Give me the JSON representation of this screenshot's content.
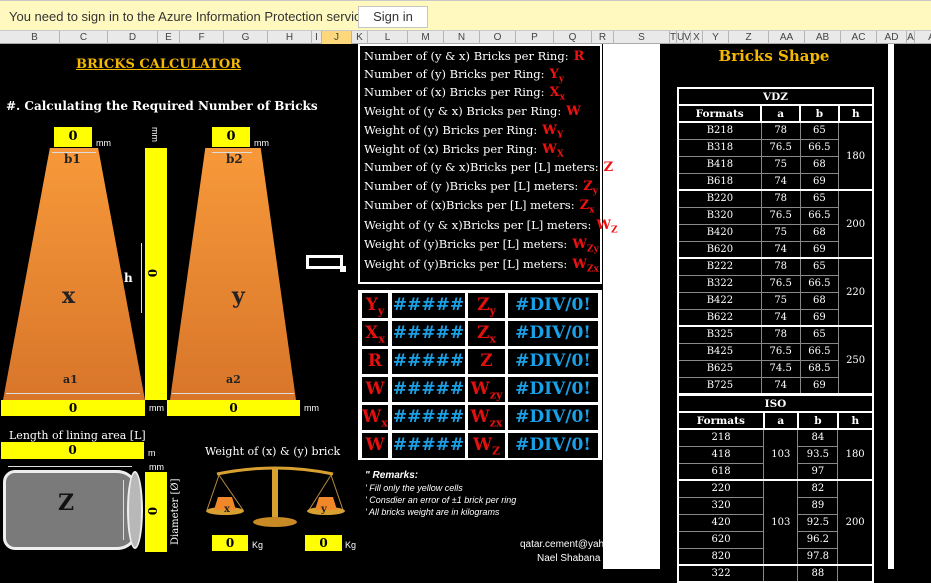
{
  "infobar": {
    "message": "You need to sign in to the Azure Information Protection service",
    "signin_label": "Sign in"
  },
  "columns": [
    "B",
    "C",
    "D",
    "E",
    "F",
    "G",
    "H",
    "I",
    "J",
    "K",
    "L",
    "M",
    "N",
    "O",
    "P",
    "Q",
    "R",
    "S",
    "T",
    "U",
    "V",
    "X",
    "Y",
    "Z",
    "AA",
    "AB",
    "AC",
    "AD",
    "A",
    "AF"
  ],
  "selected_column": "J",
  "calculator": {
    "title": "BRICKS CALCULATOR",
    "section_heading": "#. Calculating the Required Number of Bricks",
    "b1": {
      "label": "b1",
      "value": "0",
      "unit": "mm"
    },
    "b2": {
      "label": "b2",
      "value": "0",
      "unit": "mm"
    },
    "h": {
      "label": "h",
      "value": "0",
      "unit_top": "mm",
      "unit_bottom": "mm"
    },
    "a1": {
      "label": "a1",
      "value": "0",
      "unit": "mm"
    },
    "a2": {
      "label": "a2",
      "value": "0",
      "unit": "mm"
    },
    "brick_x_label": "x",
    "brick_y_label": "y",
    "length": {
      "label": "Length of lining area [L]",
      "value": "0",
      "unit": "m"
    },
    "cylinder_label": "Z",
    "diameter": {
      "label": "Diameter [Ø]",
      "value": "0",
      "unit": "mm"
    },
    "weight": {
      "label": "Weight of (x) & (y) brick",
      "x": {
        "pan_label": "x",
        "value": "0",
        "unit": "Kg"
      },
      "y": {
        "pan_label": "y",
        "value": "0",
        "unit": "Kg"
      }
    }
  },
  "definitions": [
    {
      "text": "Number of (y & x) Bricks per Ring:",
      "symbol": "R",
      "sub": ""
    },
    {
      "text": "Number of (y) Bricks per Ring:",
      "symbol": "Y",
      "sub": "y"
    },
    {
      "text": "Number of (x) Bricks per Ring:",
      "symbol": "X",
      "sub": "x"
    },
    {
      "text": "Weight of (y & x) Bricks per Ring:",
      "symbol": "W",
      "sub": ""
    },
    {
      "text": "Weight of (y) Bricks per Ring:",
      "symbol": "W",
      "sub": "Y"
    },
    {
      "text": "Weight of (x) Bricks per Ring:",
      "symbol": "W",
      "sub": "X"
    },
    {
      "text": "Number of (y & x)Bricks per [L] meters:",
      "symbol": "Z",
      "sub": ""
    },
    {
      "text": "Number of (y )Bricks per [L] meters:",
      "symbol": "Z",
      "sub": "y"
    },
    {
      "text": "Number of (x)Bricks per [L] meters:",
      "symbol": "Z",
      "sub": "x"
    },
    {
      "text": "Weight of (y & x)Bricks per  [L] meters:",
      "symbol": "W",
      "sub": "Z"
    },
    {
      "text": "Weight of (y)Bricks per [L] meters:",
      "symbol": "W",
      "sub": "Zy"
    },
    {
      "text": "Weight of (y)Bricks per [L] meters:",
      "symbol": "W",
      "sub": "Zx"
    }
  ],
  "results": [
    {
      "sym1": "Y",
      "sub1": "y",
      "val1": "#####",
      "sym2": "Z",
      "sub2": "y",
      "val2": "#DIV/0!"
    },
    {
      "sym1": "X",
      "sub1": "x",
      "val1": "#####",
      "sym2": "Z",
      "sub2": "x",
      "val2": "#DIV/0!"
    },
    {
      "sym1": "R",
      "sub1": "",
      "val1": "#####",
      "sym2": "Z",
      "sub2": "",
      "val2": "#DIV/0!"
    },
    {
      "sym1": "W",
      "sub1": "",
      "val1": "#####",
      "sym2": "W",
      "sub2": "zy",
      "val2": "#DIV/0!"
    },
    {
      "sym1": "W",
      "sub1": "x",
      "val1": "#####",
      "sym2": "W",
      "sub2": "zx",
      "val2": "#DIV/0!"
    },
    {
      "sym1": "W",
      "sub1": "",
      "val1": "#####",
      "sym2": "W",
      "sub2": "Z",
      "val2": "#DIV/0!"
    }
  ],
  "remarks": {
    "title": "Remarks:",
    "items": [
      "Fill only the yellow cells",
      "Consdier an error of  ±1 brick per ring",
      "All bricks weight are in kilograms"
    ]
  },
  "credit": {
    "email": "qatar.cement@yahoo.com",
    "name": "Nael Shabana"
  },
  "bricks_shape": {
    "title": "Bricks Shape",
    "vdz": {
      "title": "VDZ",
      "headers": [
        "Formats",
        "a",
        "b",
        "h"
      ],
      "groups": [
        {
          "h": "180",
          "rows": [
            [
              "B218",
              "78",
              "65"
            ],
            [
              "B318",
              "76.5",
              "66.5"
            ],
            [
              "B418",
              "75",
              "68"
            ],
            [
              "B618",
              "74",
              "69"
            ]
          ]
        },
        {
          "h": "200",
          "rows": [
            [
              "B220",
              "78",
              "65"
            ],
            [
              "B320",
              "76.5",
              "66.5"
            ],
            [
              "B420",
              "75",
              "68"
            ],
            [
              "B620",
              "74",
              "69"
            ]
          ]
        },
        {
          "h": "220",
          "rows": [
            [
              "B222",
              "78",
              "65"
            ],
            [
              "B322",
              "76.5",
              "66.5"
            ],
            [
              "B422",
              "75",
              "68"
            ],
            [
              "B622",
              "74",
              "69"
            ]
          ]
        },
        {
          "h": "250",
          "rows": [
            [
              "B325",
              "78",
              "65"
            ],
            [
              "B425",
              "76.5",
              "66.5"
            ],
            [
              "B625",
              "74.5",
              "68.5"
            ],
            [
              "B725",
              "74",
              "69"
            ]
          ]
        }
      ]
    },
    "iso": {
      "title": "ISO",
      "headers": [
        "Formats",
        "a",
        "b",
        "h"
      ],
      "groups": [
        {
          "a": "103",
          "h": "180",
          "rows": [
            [
              "218",
              "84"
            ],
            [
              "418",
              "93.5"
            ],
            [
              "618",
              "97"
            ]
          ]
        },
        {
          "a": "103",
          "h": "200",
          "rows": [
            [
              "220",
              "82"
            ],
            [
              "320",
              "89"
            ],
            [
              "420",
              "92.5"
            ],
            [
              "620",
              "96.2"
            ],
            [
              "820",
              "97.8"
            ]
          ]
        },
        {
          "a": "",
          "h": "",
          "rows": [
            [
              "322",
              "88"
            ]
          ]
        }
      ]
    }
  }
}
